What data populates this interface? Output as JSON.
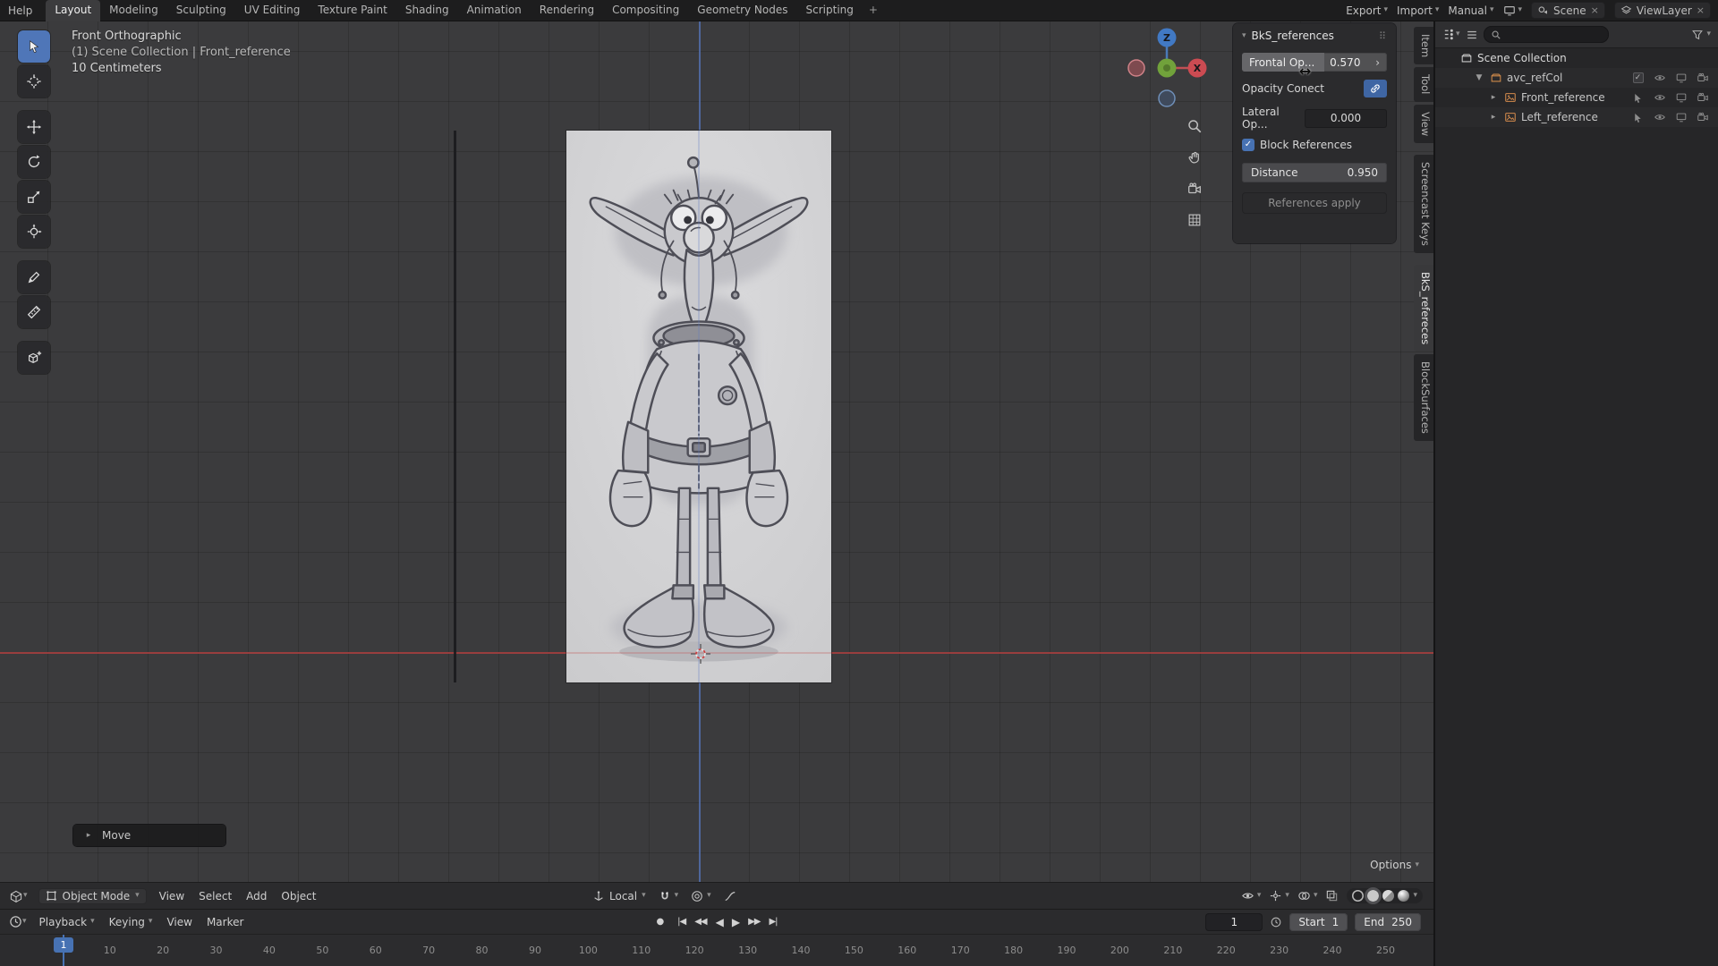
{
  "topbar": {
    "help": "Help",
    "tabs": [
      "Layout",
      "Modeling",
      "Sculpting",
      "UV Editing",
      "Texture Paint",
      "Shading",
      "Animation",
      "Rendering",
      "Compositing",
      "Geometry Nodes",
      "Scripting"
    ],
    "active_tab": "Layout",
    "add_tab": "+",
    "export": "Export",
    "import": "Import",
    "manual": "Manual",
    "scene": "Scene",
    "viewlayer": "ViewLayer"
  },
  "viewport": {
    "view_name": "Front Orthographic",
    "context_path": "(1) Scene Collection | Front_reference",
    "scale_text": "10 Centimeters",
    "move_operator": "Move",
    "options": "Options",
    "gizmo": {
      "z": "Z",
      "x": "X"
    }
  },
  "npanel": {
    "title": "BkS_references",
    "frontal_label": "Frontal Op...",
    "frontal_value": "0.570",
    "opacity_label": "Opacity Conect",
    "lateral_label": "Lateral Op...",
    "lateral_value": "0.000",
    "block_label": "Block References",
    "distance_label": "Distance",
    "distance_value": "0.950",
    "apply_label": "References apply"
  },
  "side_tabs": [
    "Item",
    "Tool",
    "View",
    "Screencast Keys",
    "BkS_refereces",
    "BlockSurfaces"
  ],
  "active_side_tab": "BkS_refereces",
  "outliner": {
    "rows": [
      {
        "label": "Scene Collection",
        "type": "scene-collection"
      },
      {
        "label": "avc_refCol",
        "type": "collection"
      },
      {
        "label": "Front_reference",
        "type": "image-empty"
      },
      {
        "label": "Left_reference",
        "type": "image-empty"
      }
    ]
  },
  "vph": {
    "mode": "Object Mode",
    "menus": [
      "View",
      "Select",
      "Add",
      "Object"
    ],
    "orientation": "Local"
  },
  "timeline": {
    "menus": [
      "Playback",
      "Keying",
      "View",
      "Marker"
    ],
    "current_frame": "1",
    "start_label": "Start",
    "start_value": "1",
    "end_label": "End",
    "end_value": "250",
    "ticks": [
      "10",
      "20",
      "30",
      "40",
      "50",
      "60",
      "70",
      "80",
      "90",
      "100",
      "110",
      "120",
      "130",
      "140",
      "150",
      "160",
      "170",
      "180",
      "190",
      "200",
      "210",
      "220",
      "230",
      "240",
      "250"
    ]
  },
  "icons": {
    "chevron_down": "▾",
    "tri_right": "▸",
    "tri_down": "▼",
    "close": "×",
    "check": "✓",
    "drag_arrow": "↔",
    "slider_right": "›",
    "dots_handle": "⠿",
    "record": "●",
    "jump_first": "|◀",
    "key_prev": "◀◀",
    "play_rev": "◀",
    "play": "▶",
    "key_next": "▶▶",
    "jump_last": "▶|"
  },
  "colors": {
    "accent": "#4772b3",
    "axis_x": "#aa4040",
    "axis_z": "#5573b4",
    "object_orange": "#d38a4c",
    "viewport_bg": "#3b3b3d"
  }
}
